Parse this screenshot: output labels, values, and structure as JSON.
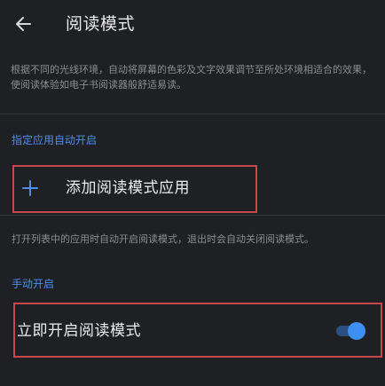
{
  "header": {
    "title": "阅读模式",
    "back_icon": "arrow-left-icon"
  },
  "description": "根据不同的光线环境，自动将屏幕的色彩及文字效果调节至所处环境相适合的效果，使阅读体验如电子书阅读器般舒适易读。",
  "auto_section": {
    "label": "指定应用自动开启",
    "add_label": "添加阅读模式应用",
    "add_icon": "plus-icon",
    "hint": "打开列表中的应用时自动开启阅读模式，退出时会自动关闭阅读模式。"
  },
  "manual_section": {
    "label": "手动开启",
    "toggle_label": "立即开启阅读模式",
    "toggle_on": true
  },
  "colors": {
    "background": "#1f2023",
    "accent": "#3d8ff2",
    "section_label": "#4d8ef0",
    "highlight_box": "#c8474c"
  }
}
